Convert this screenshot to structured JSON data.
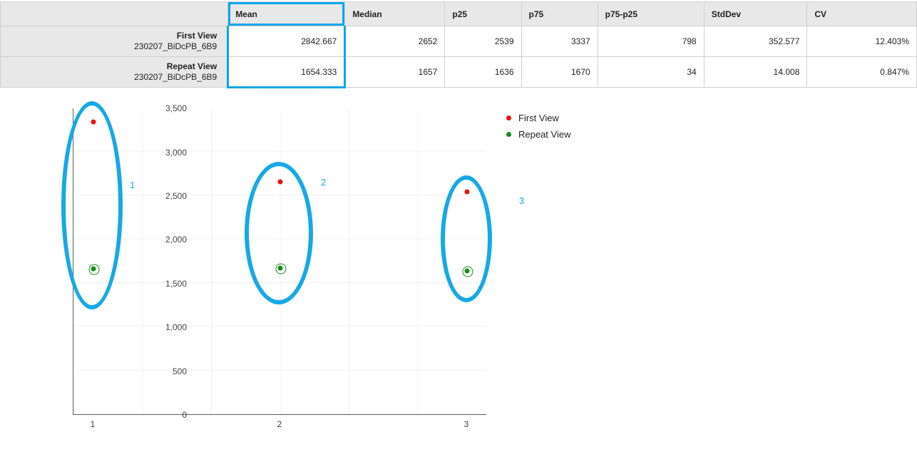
{
  "table": {
    "columns": [
      "Mean",
      "Median",
      "p25",
      "p75",
      "p75-p25",
      "StdDev",
      "CV"
    ],
    "rows": [
      {
        "label_title": "First View",
        "label_sub": "230207_BiDcPB_6B9",
        "values": [
          "2842.667",
          "2652",
          "2539",
          "3337",
          "798",
          "352.577",
          "12.403%"
        ]
      },
      {
        "label_title": "Repeat View",
        "label_sub": "230207_BiDcPB_6B9",
        "values": [
          "1654.333",
          "1657",
          "1636",
          "1670",
          "34",
          "14.008",
          "0.847%"
        ]
      }
    ],
    "highlight_col": 0
  },
  "legend": {
    "items": [
      {
        "label": "First View",
        "color": "#e11"
      },
      {
        "label": "Repeat View",
        "color": "#1a8a1a"
      }
    ]
  },
  "yticks": [
    "0",
    "500",
    "1,000",
    "1,500",
    "2,000",
    "2,500",
    "3,000",
    "3,500"
  ],
  "xticks": [
    "1",
    "2",
    "3"
  ],
  "annotations": [
    "1",
    "2",
    "3"
  ],
  "chart_data": {
    "type": "scatter",
    "title": "",
    "xlabel": "",
    "ylabel": "",
    "xlim": [
      1,
      3
    ],
    "ylim": [
      0,
      3500
    ],
    "x": [
      1,
      2,
      3
    ],
    "series": [
      {
        "name": "First View",
        "color": "#e11",
        "values": [
          3337,
          2652,
          2539
        ]
      },
      {
        "name": "Repeat View",
        "color": "#1a8a1a",
        "values": [
          1657,
          1670,
          1636
        ]
      }
    ],
    "annotations": [
      {
        "label": "1",
        "x": 1
      },
      {
        "label": "2",
        "x": 2
      },
      {
        "label": "3",
        "x": 3
      }
    ]
  }
}
